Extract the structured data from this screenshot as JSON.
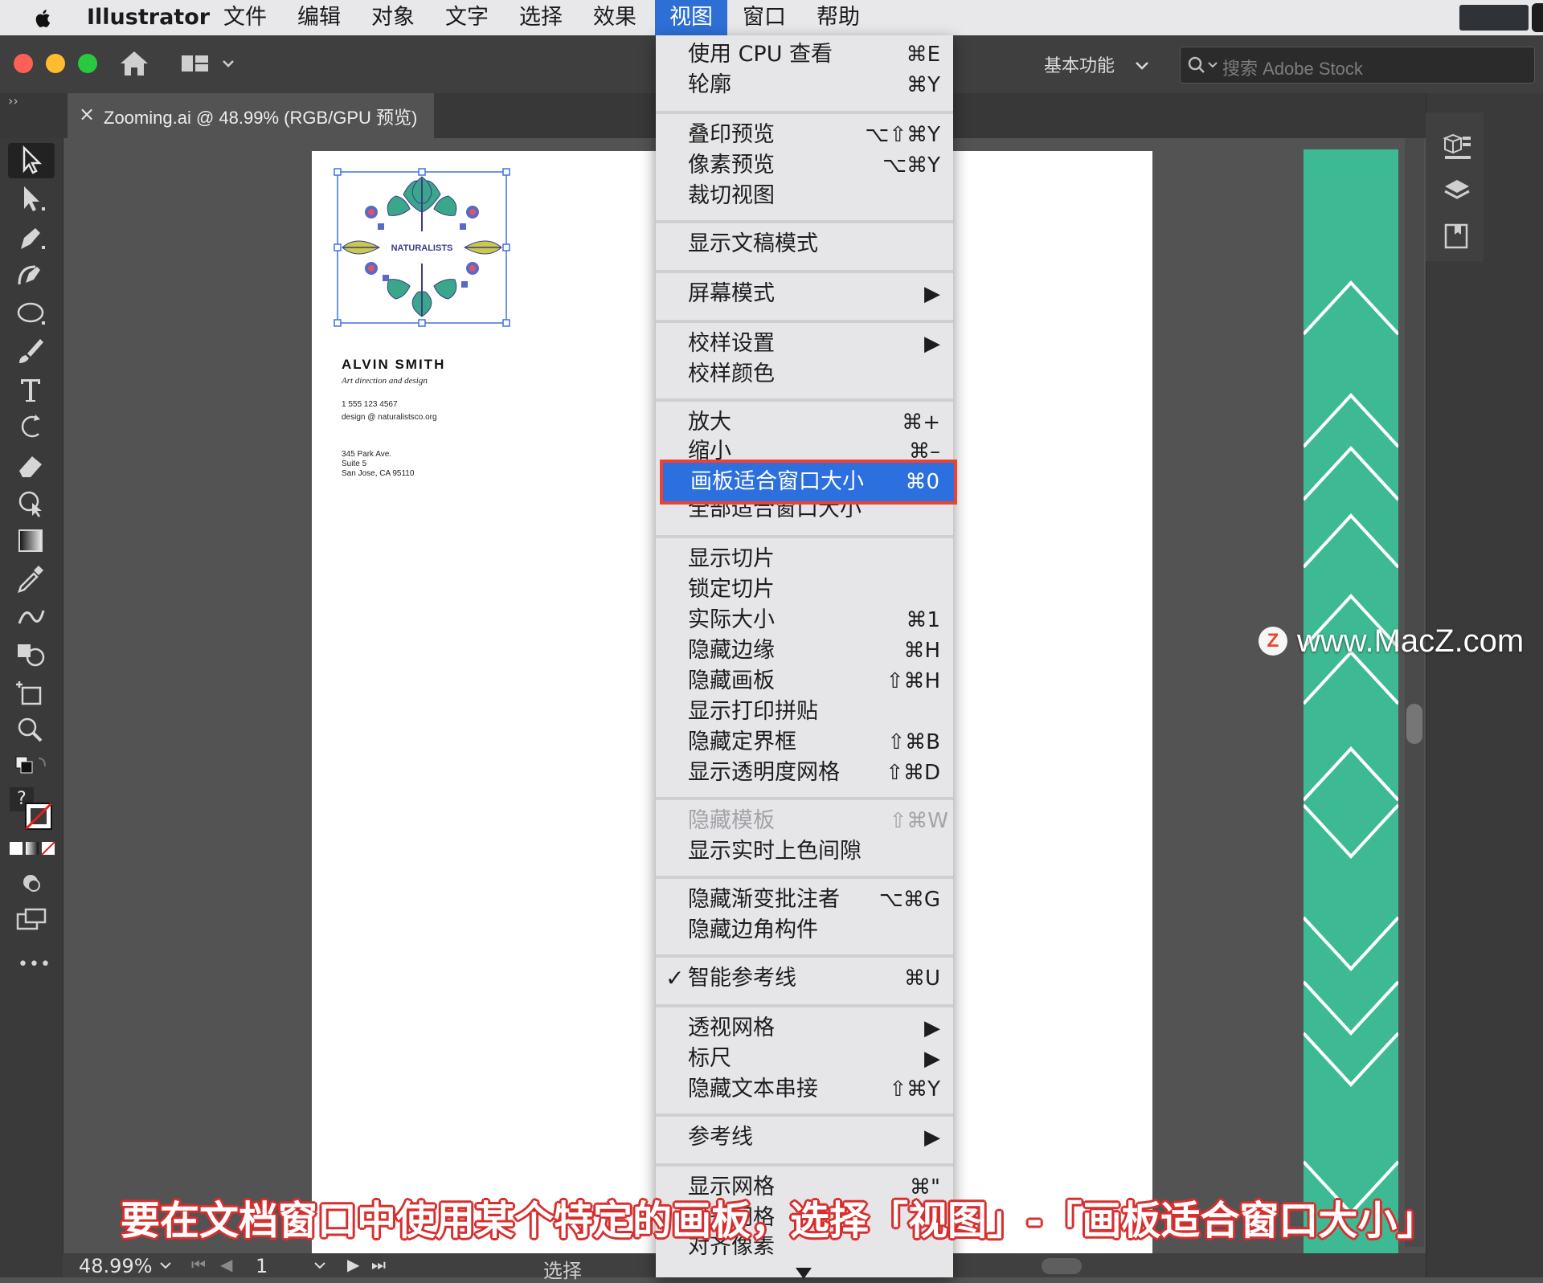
{
  "menubar": {
    "app_name": "Illustrator",
    "items": [
      "文件",
      "编辑",
      "对象",
      "文字",
      "选择",
      "效果",
      "视图",
      "窗口",
      "帮助"
    ],
    "active_item": "视图"
  },
  "appbar": {
    "workspace_label": "基本功能",
    "search_placeholder": "搜索 Adobe Stock"
  },
  "document_tab": {
    "close": "×",
    "title": "Zooming.ai @ 48.99% (RGB/GPU 预览)"
  },
  "card": {
    "logo_text": "NATURALISTS",
    "name": "ALVIN SMITH",
    "role": "Art direction and design",
    "phone": "1 555 123 4567",
    "email": "design @ naturalistsco.org",
    "address1": "345 Park Ave.",
    "address2": "Suite 5",
    "address3": "San Jose, CA 95110"
  },
  "view_menu": {
    "items": [
      {
        "label": "使用 CPU 查看",
        "shortcut": "⌘E"
      },
      {
        "label": "轮廓",
        "shortcut": "⌘Y"
      },
      {
        "label": "叠印预览",
        "shortcut": "⌥⇧⌘Y"
      },
      {
        "label": "像素预览",
        "shortcut": "⌥⌘Y"
      },
      {
        "label": "裁切视图",
        "shortcut": ""
      },
      {
        "label": "显示文稿模式",
        "shortcut": ""
      },
      {
        "label": "屏幕模式",
        "shortcut": "▶"
      },
      {
        "label": "校样设置",
        "shortcut": "▶"
      },
      {
        "label": "校样颜色",
        "shortcut": ""
      },
      {
        "label": "放大",
        "shortcut": "⌘+"
      },
      {
        "label": "缩小",
        "shortcut": "⌘–"
      },
      {
        "label": "画板适合窗口大小",
        "shortcut": "⌘0"
      },
      {
        "label": "全部适合窗口大小",
        "shortcut": ""
      },
      {
        "label": "显示切片",
        "shortcut": ""
      },
      {
        "label": "锁定切片",
        "shortcut": ""
      },
      {
        "label": "实际大小",
        "shortcut": "⌘1"
      },
      {
        "label": "隐藏边缘",
        "shortcut": "⌘H"
      },
      {
        "label": "隐藏画板",
        "shortcut": "⇧⌘H"
      },
      {
        "label": "显示打印拼贴",
        "shortcut": ""
      },
      {
        "label": "隐藏定界框",
        "shortcut": "⇧⌘B"
      },
      {
        "label": "显示透明度网格",
        "shortcut": "⇧⌘D"
      },
      {
        "label": "隐藏模板",
        "shortcut": "⇧⌘W"
      },
      {
        "label": "显示实时上色间隙",
        "shortcut": ""
      },
      {
        "label": "隐藏渐变批注者",
        "shortcut": "⌥⌘G"
      },
      {
        "label": "隐藏边角构件",
        "shortcut": ""
      },
      {
        "label": "智能参考线",
        "shortcut": "⌘U"
      },
      {
        "label": "透视网格",
        "shortcut": "▶"
      },
      {
        "label": "标尺",
        "shortcut": "▶"
      },
      {
        "label": "隐藏文本串接",
        "shortcut": "⇧⌘Y"
      },
      {
        "label": "参考线",
        "shortcut": "▶"
      },
      {
        "label": "显示网格",
        "shortcut": "⌘\""
      },
      {
        "label": "对齐网格",
        "shortcut": ""
      },
      {
        "label": "对齐像素",
        "shortcut": ""
      }
    ],
    "checkmark": "✓"
  },
  "statusbar": {
    "zoom": "48.99%",
    "page": "1",
    "mode": "选择"
  },
  "toolbar": {
    "question": "?",
    "more": "•••"
  },
  "watermark": {
    "logo": "Z",
    "text": "www.MacZ.com"
  },
  "caption": "要在文档窗口中使用某个特定的画板，选择「视图」-「画板适合窗口大小」",
  "colors": {
    "accent": "#2c6fde",
    "highlight_border": "#ee4130",
    "strip": "#3dba93",
    "leaf_green": "#3aa68a",
    "leaf_yellow": "#c9c94b",
    "berry": "#5b67c9"
  }
}
